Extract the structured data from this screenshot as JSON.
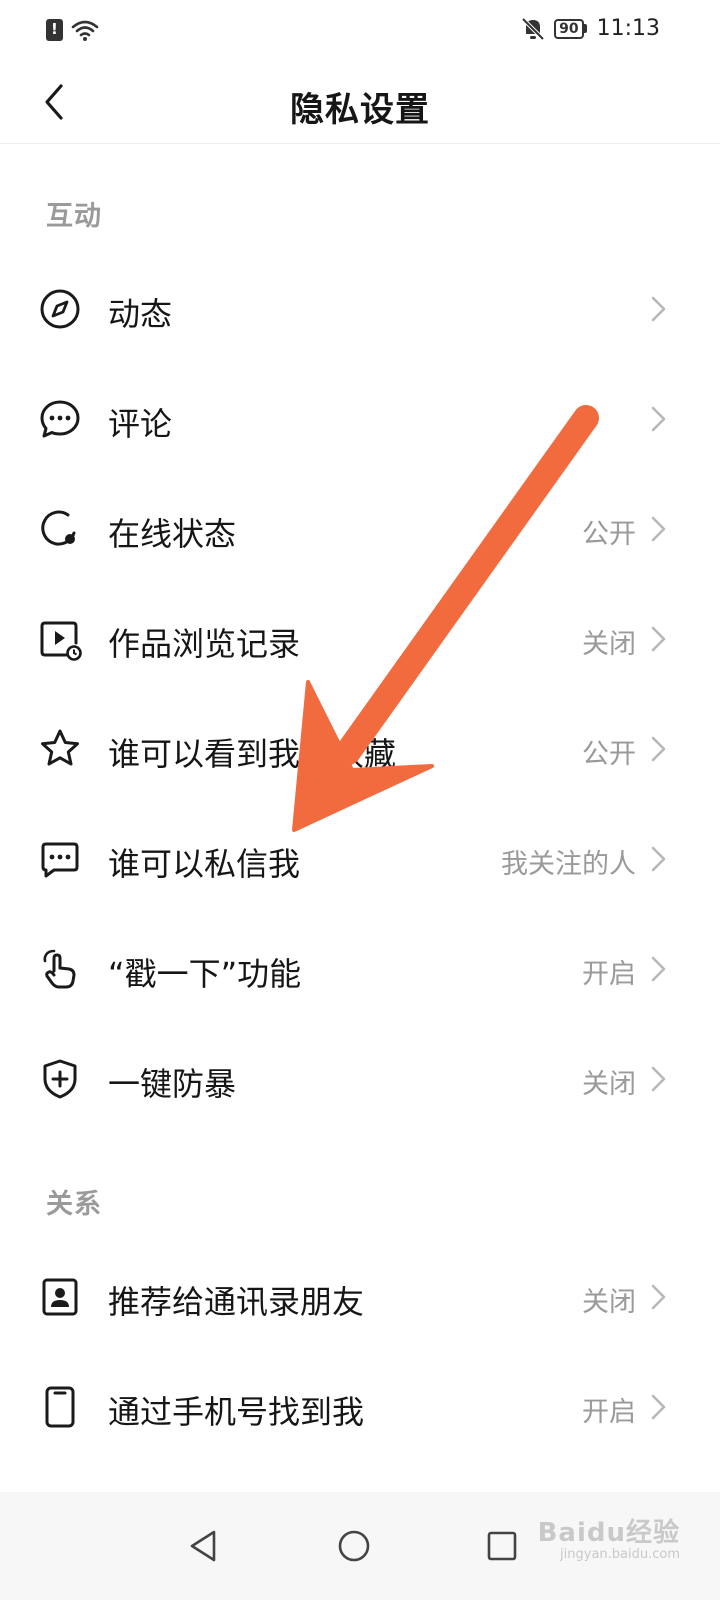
{
  "status_bar": {
    "time": "11:13",
    "battery": "90",
    "icons": [
      "alert-icon",
      "wifi-icon",
      "bell-muted-icon",
      "battery-icon"
    ]
  },
  "header": {
    "title": "隐私设置",
    "back_icon": "chevron-left-icon"
  },
  "sections": [
    {
      "title": "互动",
      "items": [
        {
          "icon": "compass-icon",
          "label": "动态",
          "value": ""
        },
        {
          "icon": "chat-bubble-icon",
          "label": "评论",
          "value": ""
        },
        {
          "icon": "online-status-icon",
          "label": "在线状态",
          "value": "公开"
        },
        {
          "icon": "play-history-icon",
          "label": "作品浏览记录",
          "value": "关闭"
        },
        {
          "icon": "star-icon",
          "label": "谁可以看到我的收藏",
          "value": "公开"
        },
        {
          "icon": "message-icon",
          "label": "谁可以私信我",
          "value": "我关注的人"
        },
        {
          "icon": "tap-hand-icon",
          "label": "“戳一下”功能",
          "value": "开启"
        },
        {
          "icon": "shield-plus-icon",
          "label": "一键防暴",
          "value": "关闭"
        }
      ]
    },
    {
      "title": "关系",
      "items": [
        {
          "icon": "contact-card-icon",
          "label": "推荐给通讯录朋友",
          "value": "关闭"
        },
        {
          "icon": "phone-icon",
          "label": "通过手机号找到我",
          "value": "开启"
        }
      ]
    }
  ],
  "nav_bar": {
    "buttons": [
      "back-triangle-icon",
      "home-circle-icon",
      "recents-square-icon"
    ]
  },
  "watermark": {
    "brand": "Baidu经验",
    "url": "jingyan.baidu.com"
  },
  "colors": {
    "annotation_arrow": "#f26b3f",
    "secondary_text": "#9a9a9a",
    "primary_text": "#161616"
  }
}
